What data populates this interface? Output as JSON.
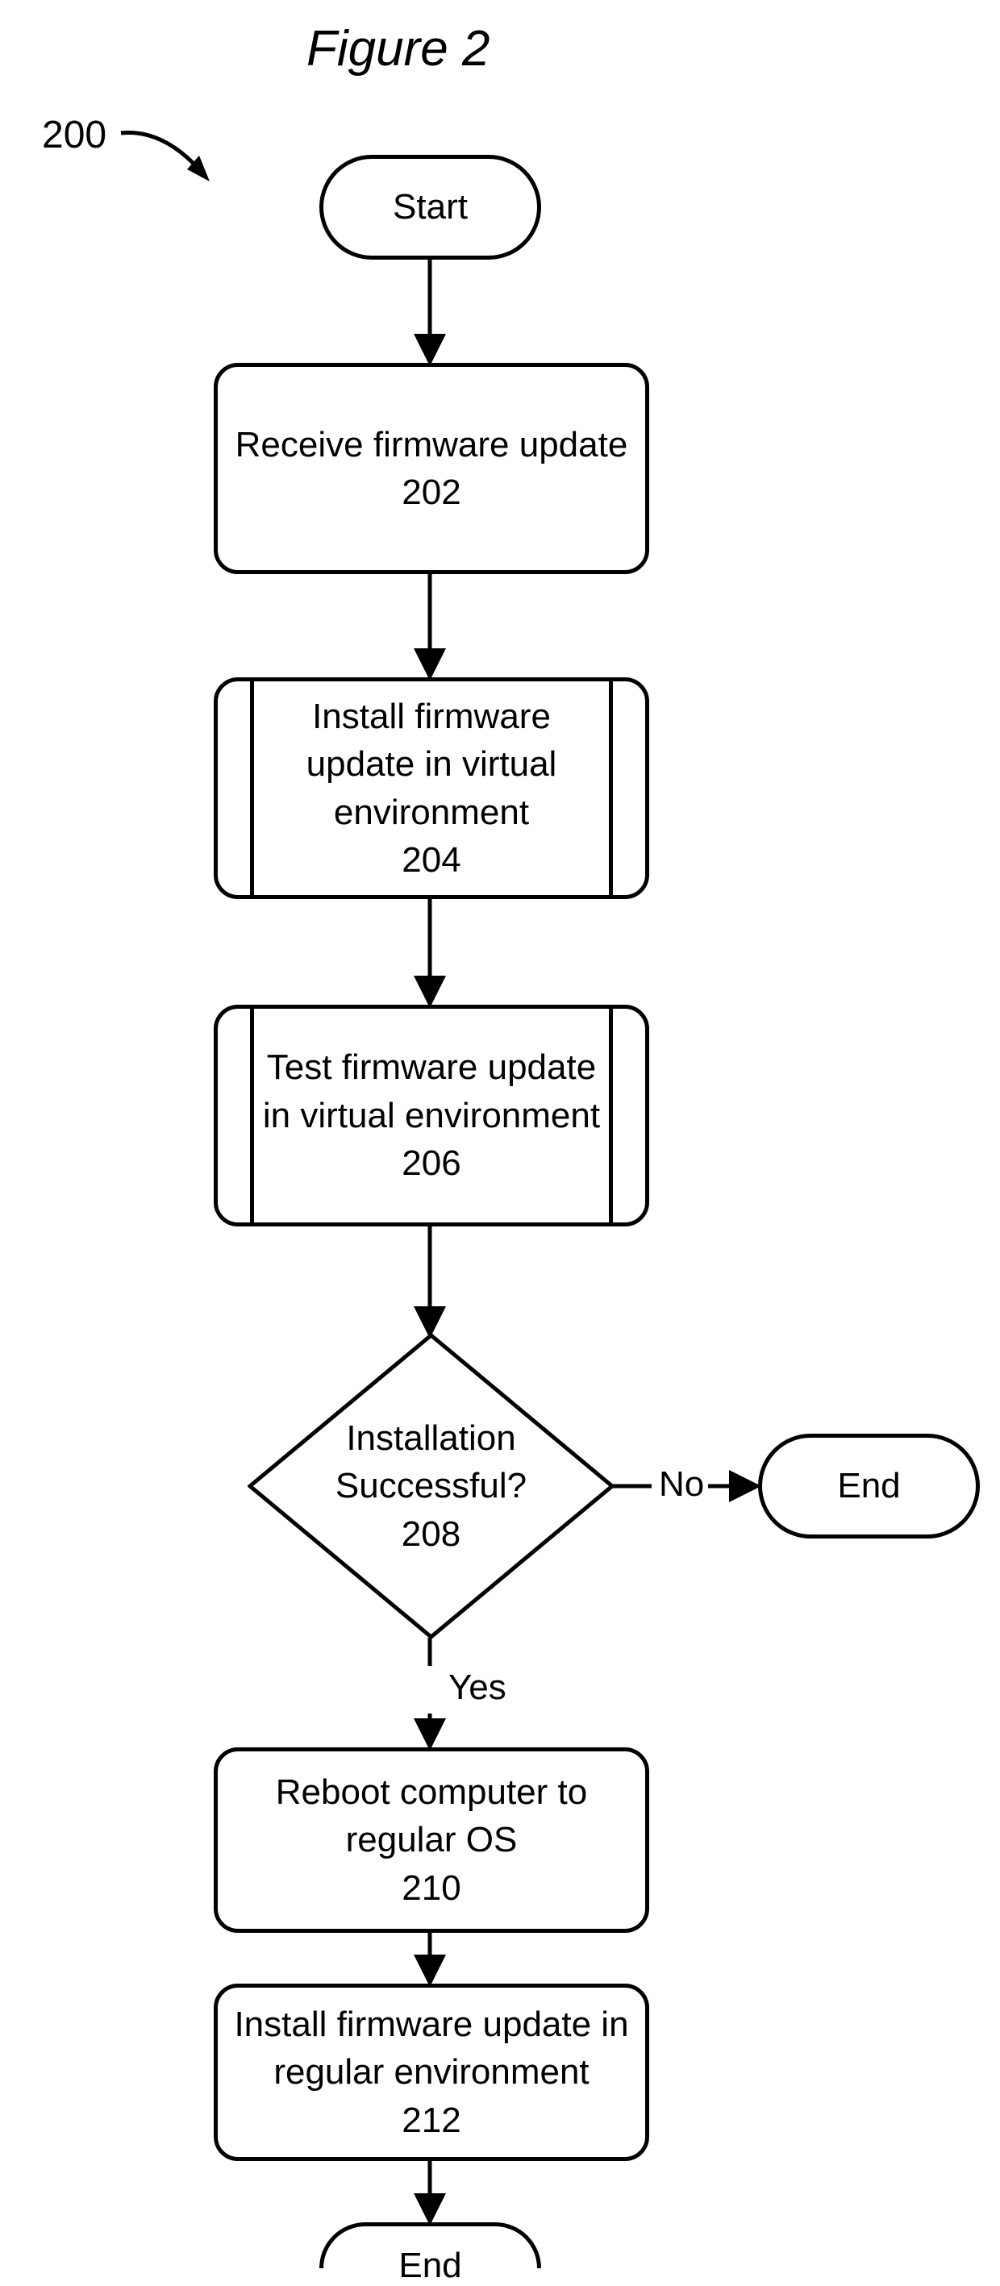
{
  "figure": {
    "title": "Figure 2",
    "ref": "200"
  },
  "nodes": {
    "start": {
      "label": "Start"
    },
    "n202": {
      "text": "Receive firmware update",
      "num": "202"
    },
    "n204": {
      "text": "Install firmware update in virtual environment",
      "num": "204"
    },
    "n206": {
      "text": "Test firmware update in virtual environment",
      "num": "206"
    },
    "n208": {
      "text": "Installation Successful?",
      "num": "208"
    },
    "n210": {
      "text": "Reboot computer to regular OS",
      "num": "210"
    },
    "n212": {
      "text": "Install firmware update in regular environment",
      "num": "212"
    },
    "end1": {
      "label": "End"
    },
    "end2": {
      "label": "End"
    }
  },
  "edges": {
    "yes": "Yes",
    "no": "No"
  }
}
